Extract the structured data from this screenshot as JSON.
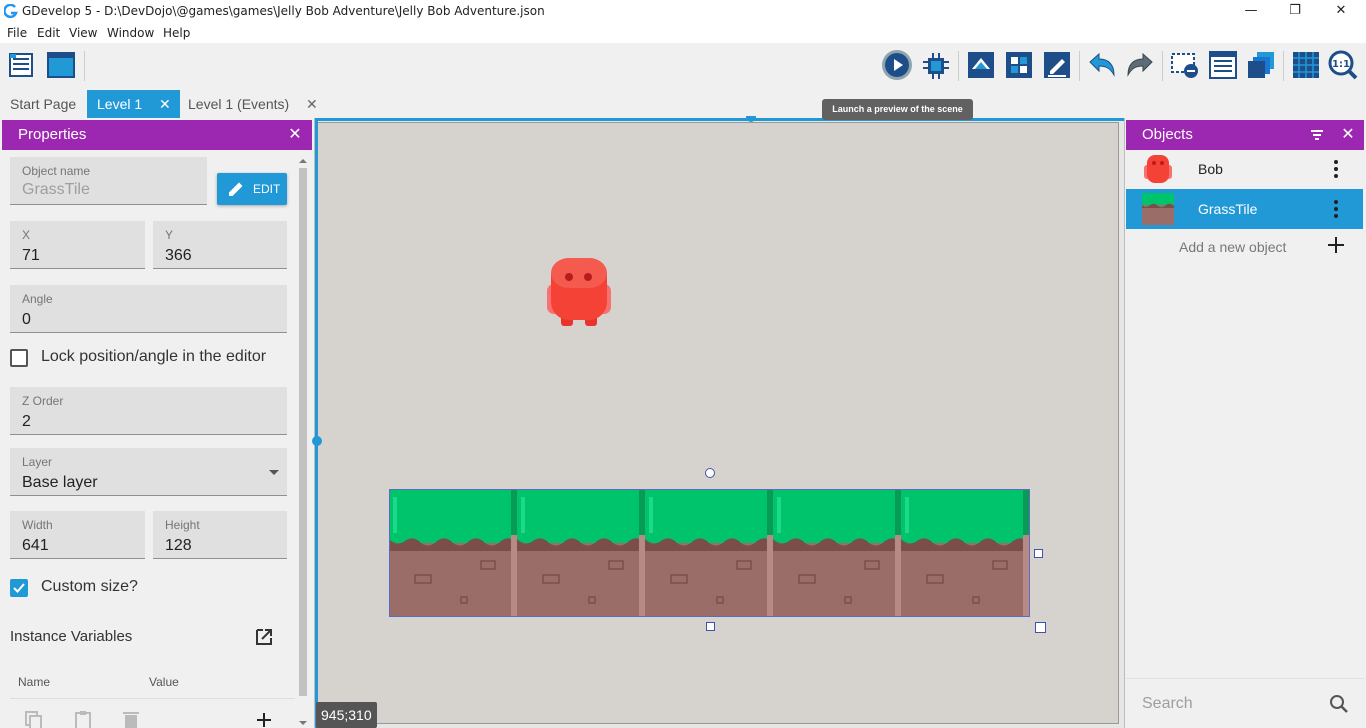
{
  "window": {
    "title": "GDevelop 5 - D:\\DevDojo\\@games\\games\\Jelly Bob Adventure\\Jelly Bob Adventure.json",
    "minimize": "—",
    "maximize": "❐",
    "close": "✕"
  },
  "menu": [
    "File",
    "Edit",
    "View",
    "Window",
    "Help"
  ],
  "tabs": [
    {
      "label": "Start Page",
      "active": false
    },
    {
      "label": "Level 1",
      "active": true
    },
    {
      "label": "Level 1 (Events)",
      "active": false
    }
  ],
  "tab_close": "✕",
  "tooltip": "Launch a preview of the scene",
  "toolbar": {
    "left_icons": [
      "project-manager-icon",
      "scene-view-icon"
    ],
    "right_icons": [
      "play-preview-icon",
      "debugger-icon",
      "objects-list-icon",
      "object-groups-icon",
      "properties-icon",
      "undo-icon",
      "redo-icon",
      "instances-list-icon",
      "layers-list-icon",
      "layers-icon",
      "grid-icon",
      "zoom-reset-icon"
    ]
  },
  "properties": {
    "title": "Properties",
    "close": "✕",
    "object_name": {
      "label": "Object name",
      "value": "GrassTile"
    },
    "edit_button": "EDIT",
    "x": {
      "label": "X",
      "value": "71"
    },
    "y": {
      "label": "Y",
      "value": "366"
    },
    "angle": {
      "label": "Angle",
      "value": "0"
    },
    "lock": {
      "label": "Lock position/angle in the editor",
      "checked": false
    },
    "z_order": {
      "label": "Z Order",
      "value": "2"
    },
    "layer": {
      "label": "Layer",
      "value": "Base layer"
    },
    "width": {
      "label": "Width",
      "value": "641"
    },
    "height": {
      "label": "Height",
      "value": "128"
    },
    "custom_size": {
      "label": "Custom size?",
      "checked": true
    },
    "instance_variables": "Instance Variables",
    "col_name": "Name",
    "col_value": "Value"
  },
  "scene": {
    "cursor_coords": "945;310",
    "background": "#d6d3cf",
    "accent": "#2199d7"
  },
  "objects": {
    "title": "Objects",
    "close": "✕",
    "items": [
      {
        "name": "Bob",
        "selected": false
      },
      {
        "name": "GrassTile",
        "selected": true
      }
    ],
    "add_label": "Add a new object",
    "search_placeholder": "Search"
  },
  "colors": {
    "panel_header": "#9c27b0",
    "accent_blue": "#2199d7",
    "bob_red": "#f44336",
    "grass_green": "#00c46c",
    "dirt_brown": "#9b6d69"
  }
}
